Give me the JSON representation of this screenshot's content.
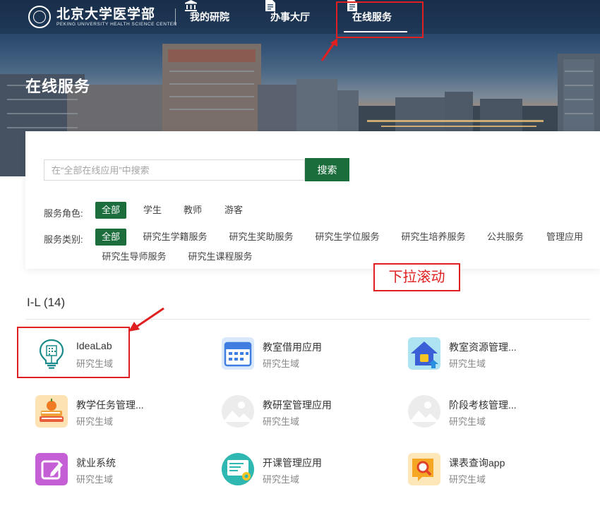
{
  "header": {
    "logo_cn": "北京大学医学部",
    "logo_en": "PEKING UNIVERSITY HEALTH SCIENCE CENTER",
    "nav": [
      {
        "label": "我的研院",
        "icon": "bank-icon"
      },
      {
        "label": "办事大厅",
        "icon": "document-icon"
      },
      {
        "label": "在线服务",
        "icon": "document-icon",
        "active": true
      }
    ]
  },
  "banner": {
    "title": "在线服务"
  },
  "search": {
    "placeholder": "在“全部在线应用”中搜索",
    "value": "",
    "button": "搜索"
  },
  "filters": {
    "role_label": "服务角色:",
    "roles": [
      "全部",
      "学生",
      "教师",
      "游客"
    ],
    "category_label": "服务类别:",
    "categories": [
      "全部",
      "研究生学籍服务",
      "研究生奖助服务",
      "研究生学位服务",
      "研究生培养服务",
      "公共服务",
      "管理应用",
      "研究生导师服务",
      "研究生课程服务"
    ]
  },
  "annotation": {
    "scroll_hint": "下拉滚动"
  },
  "group": {
    "title": "I-L (14)",
    "apps": [
      {
        "name": "IdeaLab",
        "domain": "研究生域",
        "icon": "lightbulb-icon"
      },
      {
        "name": "教室借用应用",
        "domain": "研究生域",
        "icon": "calendar-icon"
      },
      {
        "name": "教室资源管理...",
        "domain": "研究生域",
        "icon": "house-icon"
      },
      {
        "name": "教学任务管理...",
        "domain": "研究生域",
        "icon": "books-icon"
      },
      {
        "name": "教研室管理应用",
        "domain": "研究生域",
        "icon": "image-placeholder-icon"
      },
      {
        "name": "阶段考核管理...",
        "domain": "研究生域",
        "icon": "image-placeholder-icon"
      },
      {
        "name": "就业系统",
        "domain": "研究生域",
        "icon": "edit-icon"
      },
      {
        "name": "开课管理应用",
        "domain": "研究生域",
        "icon": "presentation-icon"
      },
      {
        "name": "课表查询app",
        "domain": "研究生域",
        "icon": "search-document-icon"
      }
    ]
  },
  "colors": {
    "accent": "#1b6e3c",
    "highlight": "#e02020"
  }
}
